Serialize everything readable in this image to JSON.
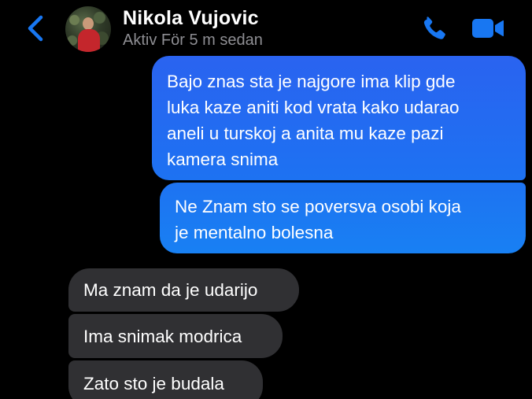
{
  "header": {
    "contact_name": "Nikola Vujovic",
    "status": "Aktiv För 5 m sedan",
    "back_icon": "chevron-left-icon",
    "call_icon": "phone-icon",
    "video_icon": "video-camera-icon",
    "accent_color": "#1877f2"
  },
  "messages": [
    {
      "direction": "outgoing",
      "lines": [
        "Bajo znas sta je najgore ima klip gde",
        "luka kaze aniti kod vrata kako udarao",
        "aneli u turskoj a anita mu kaze pazi",
        "kamera snima"
      ]
    },
    {
      "direction": "outgoing",
      "lines": [
        "Ne Znam sto se poversva osobi koja",
        "je mentalno bolesna"
      ]
    },
    {
      "direction": "incoming",
      "lines": [
        "Ma znam da je udarijo"
      ]
    },
    {
      "direction": "incoming",
      "lines": [
        "Ima snimak modrica"
      ]
    },
    {
      "direction": "incoming",
      "lines": [
        "Zato sto je budala"
      ]
    }
  ],
  "colors": {
    "background": "#000000",
    "outgoing_bubble": "#1d72f2",
    "incoming_bubble": "#303033",
    "status_text": "#8e8e93"
  }
}
